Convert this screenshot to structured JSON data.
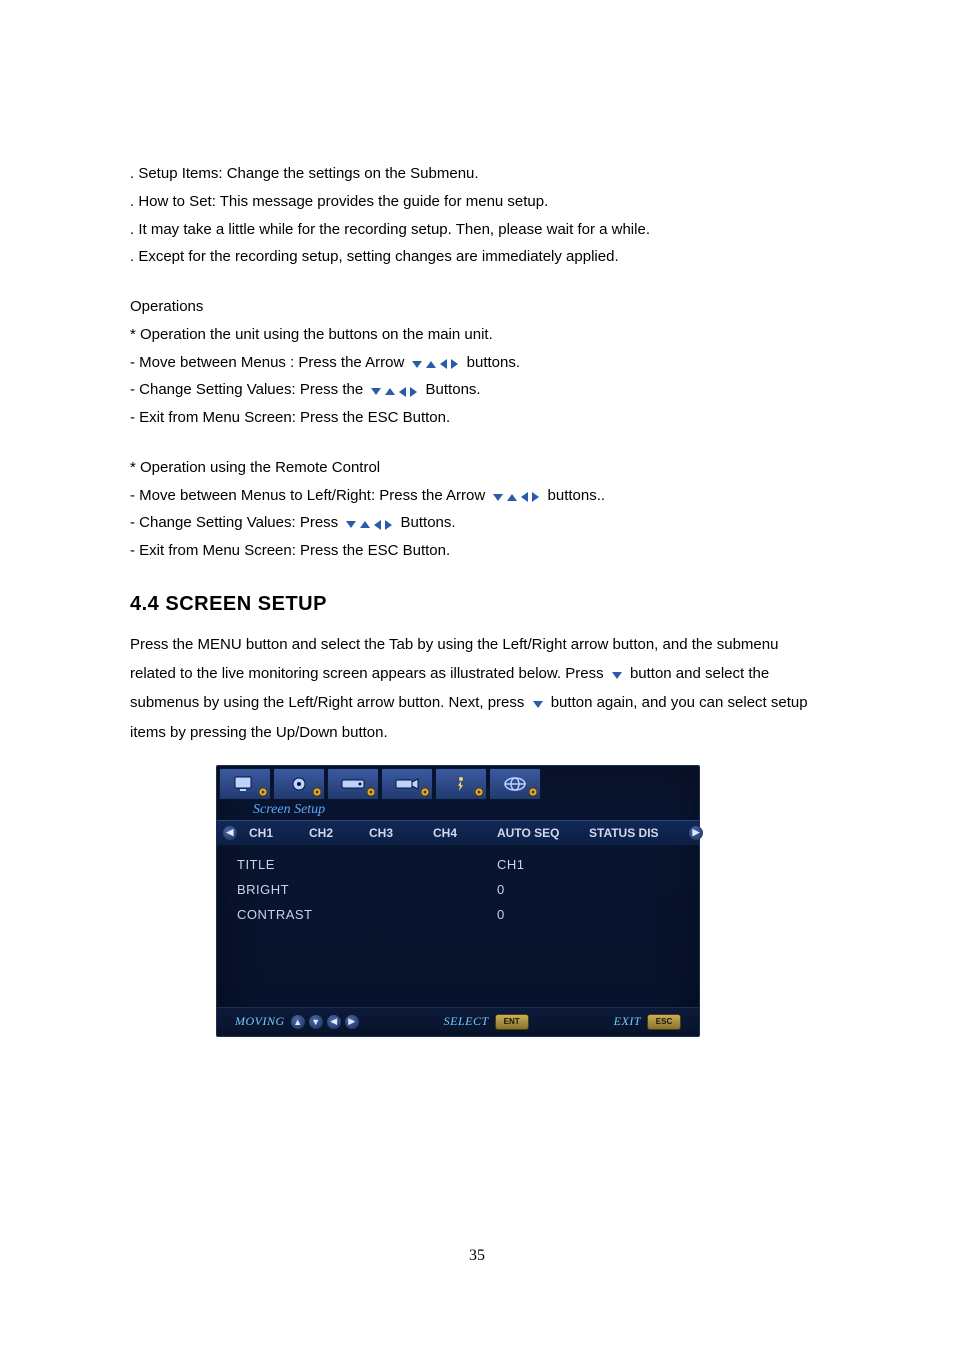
{
  "intro": [
    ". Setup Items: Change the settings on the Submenu.",
    ". How to Set: This message provides the guide for menu setup.",
    ". It may take a little while for the recording setup. Then, please wait for a while.",
    ". Except for the recording setup, setting changes are immediately applied."
  ],
  "operations": {
    "heading": "Operations",
    "unit_heading": "* Operation the unit using the buttons on the main unit.",
    "unit_lines": {
      "move_pre": "- Move between Menus : Press the Arrow",
      "move_post": "buttons.",
      "change_pre": "- Change Setting Values: Press the",
      "change_post": "Buttons.",
      "exit": "- Exit from Menu Screen: Press the ESC Button."
    },
    "remote_heading": "* Operation using the Remote Control",
    "remote_lines": {
      "move_pre": "- Move between Menus to Left/Right: Press the Arrow",
      "move_post": "buttons..",
      "change_pre": "- Change Setting Values: Press",
      "change_post": "Buttons.",
      "exit": "- Exit from Menu Screen: Press the ESC Button."
    }
  },
  "section": {
    "title": "4.4 SCREEN SETUP",
    "para_pre": "Press the MENU button and select the Tab by using the Left/Right arrow button, and the submenu related to the live monitoring screen appears as illustrated below. Press",
    "para_mid1": "button and select the submenus by using the Left/Right arrow button. Next, press",
    "para_mid2": "button again, and you can select setup items by pressing the Up/Down button."
  },
  "dvr": {
    "title": "Screen Setup",
    "subtabs": [
      "CH1",
      "CH2",
      "CH3",
      "CH4",
      "AUTO SEQ",
      "STATUS DIS"
    ],
    "rows": [
      {
        "label": "TITLE",
        "value": "CH1"
      },
      {
        "label": "BRIGHT",
        "value": "0"
      },
      {
        "label": "CONTRAST",
        "value": "0"
      }
    ],
    "footer": {
      "moving": "MOVING",
      "select": "SELECT",
      "select_key": "ENT",
      "exit": "EXIT",
      "exit_key": "ESC"
    }
  },
  "page_number": "35"
}
